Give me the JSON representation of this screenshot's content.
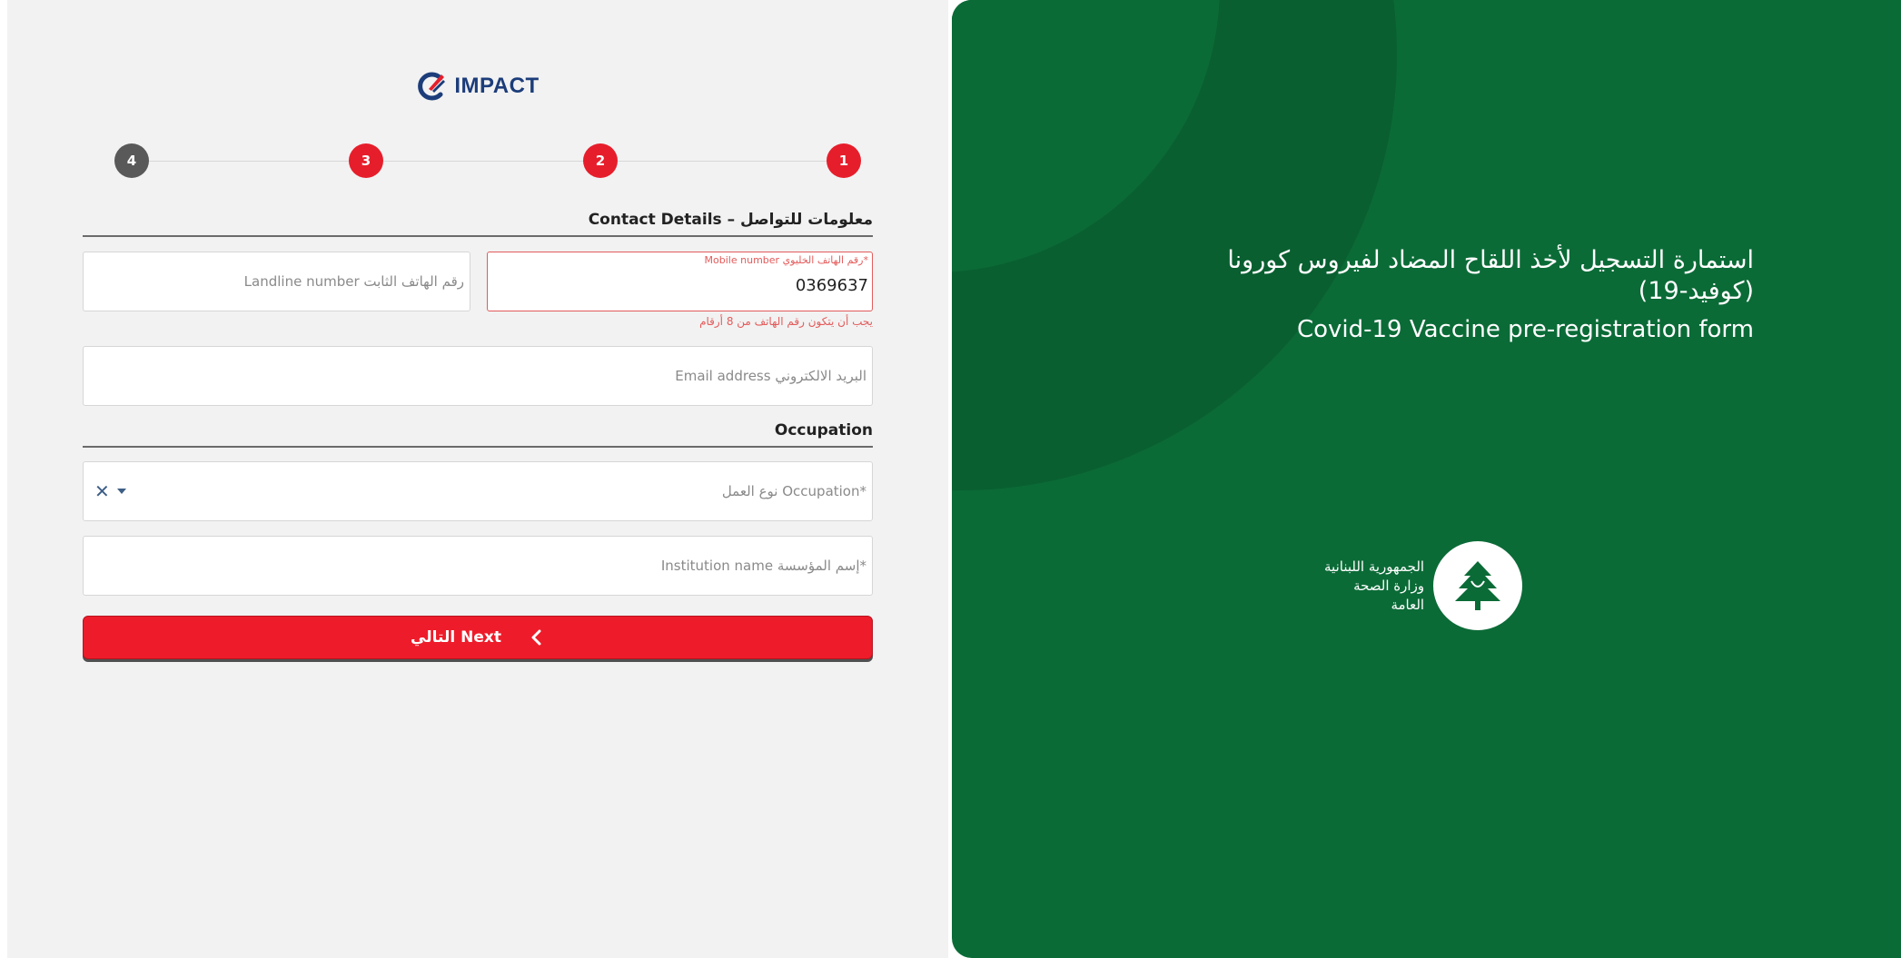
{
  "brand": {
    "logo_text": "IMPACT"
  },
  "stepper": {
    "steps": [
      "4",
      "3",
      "2",
      "1"
    ]
  },
  "contact": {
    "section_title": "Contact Details – معلومات للتواصل",
    "mobile": {
      "label": "Mobile number رقم الهاتف الخليوي*",
      "value": "0369637",
      "error": "يجب أن يتكون رقم الهاتف من 8 أرقام"
    },
    "landline": {
      "placeholder": "Landline number رقم الهاتف الثابت"
    },
    "email": {
      "placeholder": "Email address البريد الالكتروني"
    }
  },
  "occupation": {
    "section_title": "Occupation",
    "occupation_type": {
      "placeholder": "نوع العمل Occupation*"
    },
    "institution": {
      "placeholder": "Institution name إسم المؤسسة*"
    }
  },
  "next_button": {
    "label": "التالي Next"
  },
  "hero": {
    "title_ar": "استمارة التسجيل لأخذ اللقاح المضاد لفيروس كورونا (كوفيد-19)",
    "title_en": "Covid-19 Vaccine pre-registration form"
  },
  "ministry": {
    "lines": [
      "الجمهورية اللبنانية",
      "وزارة الصحة",
      "العامة"
    ]
  },
  "colors": {
    "primary_red": "#ee1c2a",
    "step_gray": "#595959",
    "panel_green": "#0b6b37",
    "error": "#e35b5b"
  }
}
